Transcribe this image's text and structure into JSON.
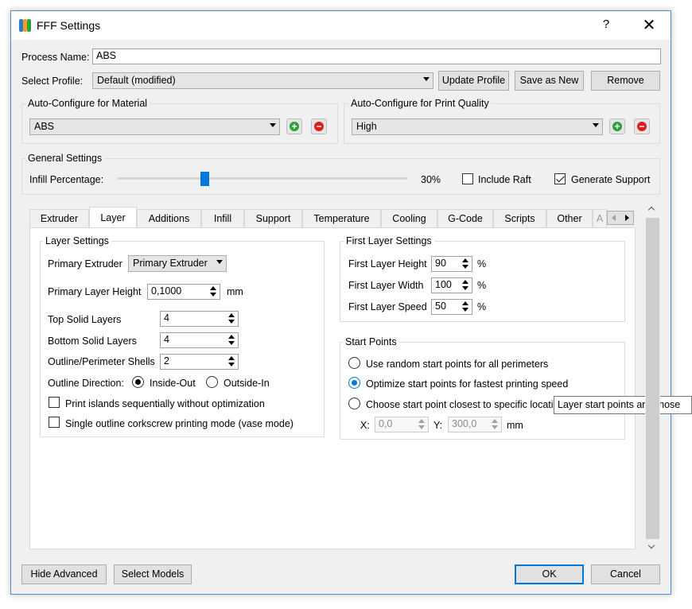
{
  "window": {
    "title": "FFF Settings",
    "help": "?",
    "close": "✕"
  },
  "process_name": {
    "label": "Process Name:",
    "value": "ABS"
  },
  "select_profile": {
    "label": "Select Profile:",
    "value": "Default (modified)"
  },
  "profile_buttons": {
    "update": "Update Profile",
    "save_new": "Save as New",
    "remove": "Remove"
  },
  "auto_material": {
    "title": "Auto-Configure for Material",
    "value": "ABS"
  },
  "auto_quality": {
    "title": "Auto-Configure for Print Quality",
    "value": "High"
  },
  "icons": {
    "add": "+",
    "remove": "−"
  },
  "general": {
    "title": "General Settings",
    "infill_label": "Infill Percentage:",
    "infill_value": "30%",
    "infill_fraction": 0.3,
    "raft_label": "Include Raft",
    "raft_checked": false,
    "support_label": "Generate Support",
    "support_checked": true
  },
  "tabs": [
    "Extruder",
    "Layer",
    "Additions",
    "Infill",
    "Support",
    "Temperature",
    "Cooling",
    "G-Code",
    "Scripts",
    "Other",
    "A"
  ],
  "active_tab": "Layer",
  "layer_settings": {
    "title": "Layer Settings",
    "primary_extruder_label": "Primary Extruder",
    "primary_extruder_value": "Primary Extruder",
    "layer_height_label": "Primary Layer Height",
    "layer_height_value": "0,1000",
    "layer_height_unit": "mm",
    "top_solid_label": "Top Solid Layers",
    "top_solid_value": "4",
    "bottom_solid_label": "Bottom Solid Layers",
    "bottom_solid_value": "4",
    "shells_label": "Outline/Perimeter Shells",
    "shells_value": "2",
    "direction_label": "Outline Direction:",
    "inside_out": "Inside-Out",
    "outside_in": "Outside-In",
    "islands_label": "Print islands sequentially without optimization",
    "vase_label": "Single outline corkscrew printing mode (vase mode)"
  },
  "first_layer": {
    "title": "First Layer Settings",
    "height_label": "First Layer Height",
    "height_value": "90",
    "width_label": "First Layer Width",
    "width_value": "100",
    "speed_label": "First Layer Speed",
    "speed_value": "50",
    "unit": "%"
  },
  "start_points": {
    "title": "Start Points",
    "opt_random": "Use random start points for all perimeters",
    "opt_optimize": "Optimize start points for fastest printing speed",
    "opt_closest": "Choose start point closest to specific locati",
    "x_label": "X:",
    "x_value": "0,0",
    "y_label": "Y:",
    "y_value": "300,0",
    "unit": "mm"
  },
  "tooltip": "Layer start points are chose",
  "footer": {
    "hide_advanced": "Hide Advanced",
    "select_models": "Select Models",
    "ok": "OK",
    "cancel": "Cancel"
  }
}
